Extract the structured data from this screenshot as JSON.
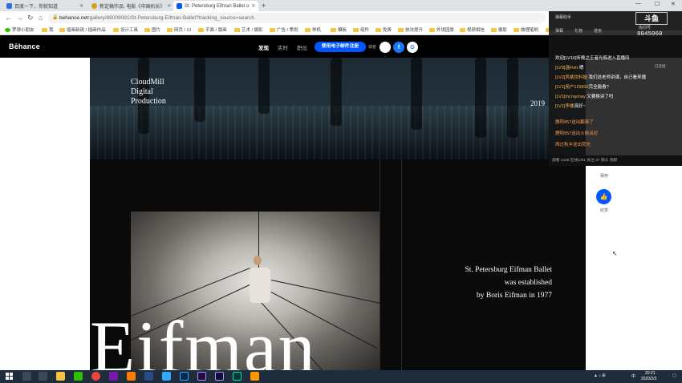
{
  "browser": {
    "tabs": [
      {
        "label": "百度一下，你就知道",
        "favicon_color": "#2f6fe4",
        "active": false
      },
      {
        "label": "新定稿作品: 电影《中国机长》",
        "favicon_color": "#d4a017",
        "active": false
      },
      {
        "label": "St. Petersburg Eifman Ballet o",
        "favicon_color": "#0057ff",
        "active": true
      }
    ],
    "url_host": "behance.net",
    "url_path": "/gallery/88009081/St-Petersburg-Eifman-Ballet?tracking_source=search",
    "bookmarks": [
      "罗律小朋友",
      "我",
      "插画新锐 / 插画作品",
      "设计工具",
      "图片",
      "网页 / UI",
      "平面 / 版画",
      "艺术 / 摄影",
      "广告 / 策划",
      "样机",
      "模板",
      "组件",
      "免费",
      "技法提升",
      "外境园景",
      "视频相信",
      "摄影",
      "故理笔刷",
      "教学"
    ]
  },
  "behance": {
    "logo": "Bēhance",
    "nav": [
      "发现",
      "实时",
      "职位"
    ],
    "signup_label": "使用电子邮件注册",
    "or_label": "或者",
    "social": [
      {
        "name": "apple",
        "glyph": "",
        "bg": "#ffffff",
        "fg": "#000000"
      },
      {
        "name": "facebook",
        "glyph": "f",
        "bg": "#1877f2",
        "fg": "#ffffff"
      },
      {
        "name": "google",
        "glyph": "G",
        "bg": "#ffffff",
        "fg": "#4285f4"
      }
    ]
  },
  "project": {
    "hero_title_lines": [
      "CloudMill",
      "Digital",
      "Production"
    ],
    "hero_year": "2019",
    "caption_lines": [
      "St. Petersburg Eifman Ballet",
      "was established",
      "by Boris Eifman in 1977"
    ],
    "big_text": "Eifman"
  },
  "sidebar": {
    "save_label": "保存",
    "appreciate_label": "欣赏"
  },
  "overlay": {
    "title": "弹幕助手",
    "logo": "斗鱼",
    "room_label": "房间号",
    "room_number": "8045060",
    "tabs": [
      "弹幕",
      "礼物",
      "进房"
    ],
    "messages": [
      {
        "user": "",
        "text": "欢迎[LV16]听晚之王者光临进入直播间",
        "system": false
      },
      {
        "user": "[LV9]温Fish:",
        "text": "嗯",
        "system": false
      },
      {
        "user": "[LV2]风格饮料姐:",
        "text": "我们这老师讲课，自己看来播",
        "system": false
      },
      {
        "user": "[LV1]用户129832",
        "text": "完全能看?",
        "system": false
      },
      {
        "user": "[LV1]mcraymay:",
        "text": "又要换讲了吗",
        "system": false
      },
      {
        "user": "[LV1]李楼",
        "text": "真好~",
        "system": false
      },
      {
        "user": "",
        "text": "鹿阿957送出翻滚了",
        "system": true
      },
      {
        "user": "",
        "text": "鹿阿957送出火箭派对",
        "system": true
      },
      {
        "user": "",
        "text": "两过秋半送出荧光",
        "system": true
      }
    ],
    "badge": "已连接",
    "status": "观看 2168 在线1/81 关注 37 观众 贡献"
  },
  "taskbar": {
    "apps": [
      {
        "name": "search",
        "color": "#3a4a5c"
      },
      {
        "name": "taskview",
        "color": "#3a4a5c"
      },
      {
        "name": "explorer",
        "color": "#f5c242"
      },
      {
        "name": "wechat",
        "color": "#2dc100"
      },
      {
        "name": "chrome",
        "color": "#e8453c"
      },
      {
        "name": "onenote",
        "color": "#7719aa"
      },
      {
        "name": "illustrator",
        "color": "#ff7c00"
      },
      {
        "name": "cinema",
        "color": "#2b4a8b"
      },
      {
        "name": "photoshop",
        "color": "#31a8ff"
      },
      {
        "name": "premiere",
        "color": "#9999ff"
      },
      {
        "name": "aftereffects",
        "color": "#9999ff"
      },
      {
        "name": "audition",
        "color": "#00e4bb"
      },
      {
        "name": "sublime",
        "color": "#ff9800"
      }
    ],
    "time": "20:21",
    "date": "2020/2/3",
    "ime": "中"
  }
}
